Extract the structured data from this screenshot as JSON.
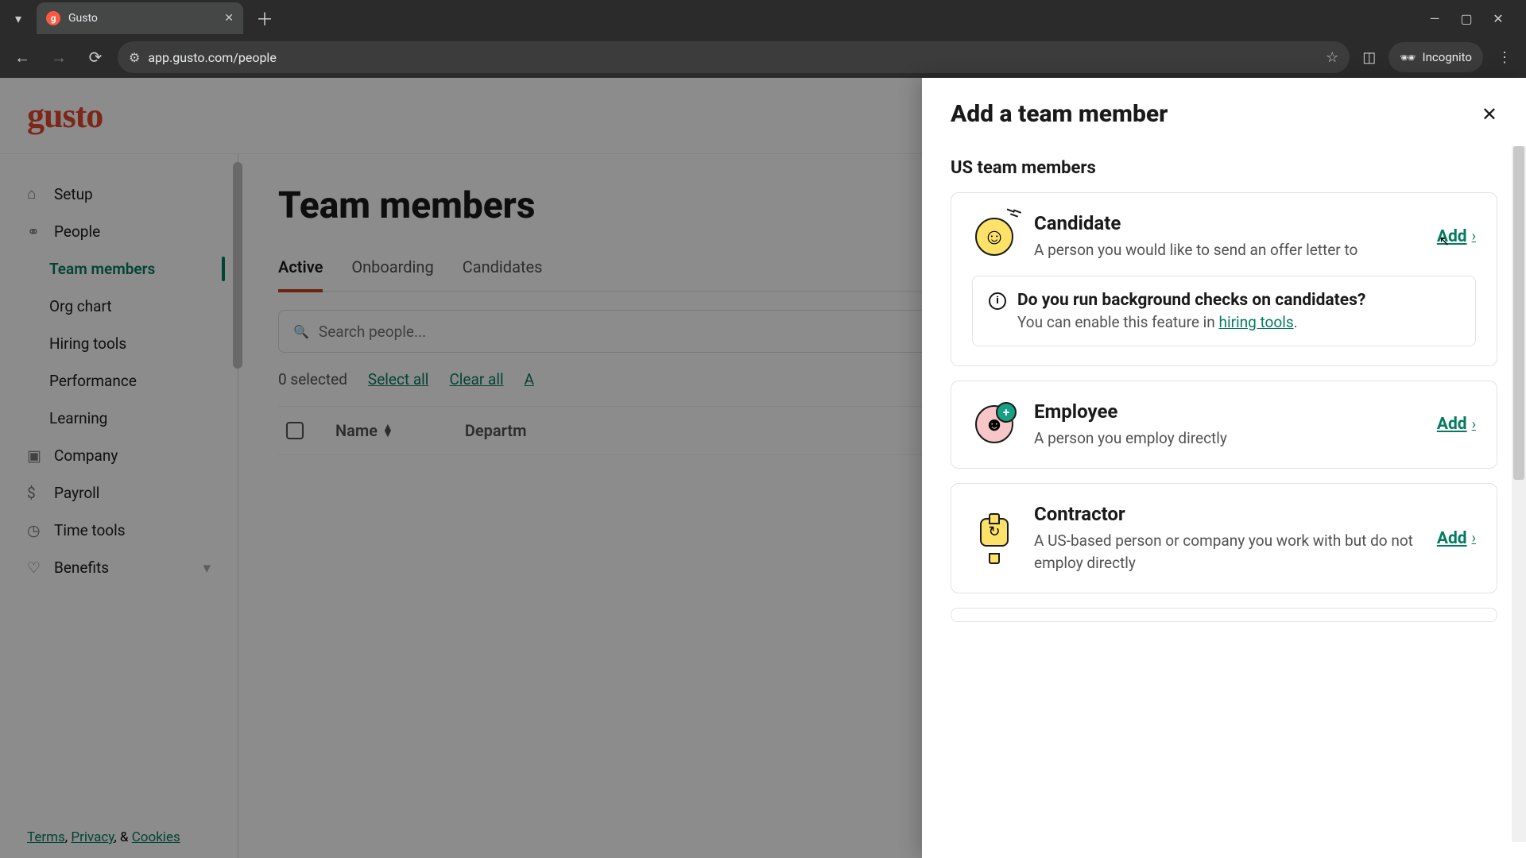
{
  "browser": {
    "tab_title": "Gusto",
    "url": "app.gusto.com/people",
    "incognito_label": "Incognito"
  },
  "app": {
    "logo": "gusto",
    "sidebar": {
      "items": [
        {
          "label": "Setup",
          "icon": "home"
        },
        {
          "label": "People",
          "icon": "people"
        },
        {
          "label": "Team members",
          "sub": true,
          "active": true
        },
        {
          "label": "Org chart",
          "sub": true
        },
        {
          "label": "Hiring tools",
          "sub": true
        },
        {
          "label": "Performance",
          "sub": true
        },
        {
          "label": "Learning",
          "sub": true
        },
        {
          "label": "Company",
          "icon": "company"
        },
        {
          "label": "Payroll",
          "icon": "payroll"
        },
        {
          "label": "Time tools",
          "icon": "time"
        },
        {
          "label": "Benefits",
          "icon": "benefits",
          "chev": true
        }
      ],
      "footer_terms": "Terms",
      "footer_privacy": "Privacy",
      "footer_and": ", & ",
      "footer_cookies": "Cookies"
    },
    "main": {
      "title": "Team members",
      "tabs": [
        {
          "label": "Active",
          "active": true
        },
        {
          "label": "Onboarding"
        },
        {
          "label": "Candidates"
        }
      ],
      "search_placeholder": "Search people...",
      "selected_text": "0 selected",
      "select_all": "Select all",
      "clear_all": "Clear all",
      "actions_partial": "A",
      "col_name": "Name",
      "col_dept": "Departm"
    }
  },
  "drawer": {
    "title": "Add a team member",
    "section": "US team members",
    "add_label": "Add",
    "cards": [
      {
        "title": "Candidate",
        "desc": "A person you would like to send an offer letter to",
        "info_title": "Do you run background checks on candidates?",
        "info_body_pre": "You can enable this feature in ",
        "info_link": "hiring tools",
        "info_body_post": "."
      },
      {
        "title": "Employee",
        "desc": "A person you employ directly"
      },
      {
        "title": "Contractor",
        "desc": "A US-based person or company you work with but do not employ directly"
      }
    ]
  }
}
